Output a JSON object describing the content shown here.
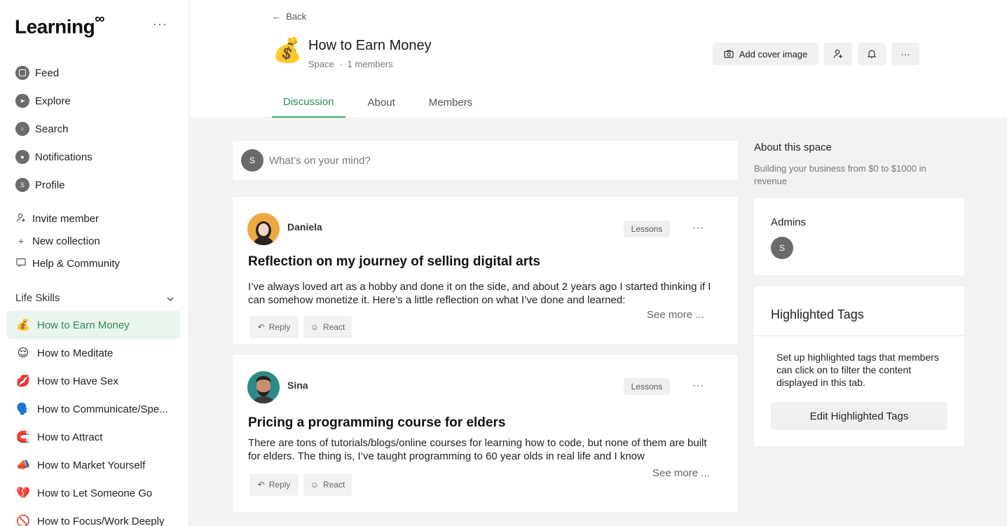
{
  "sidebar": {
    "logo": "Learning",
    "logo_mark": "∞",
    "more": "···",
    "nav": [
      {
        "label": "Feed",
        "icon": "feed-icon"
      },
      {
        "label": "Explore",
        "icon": "compass-icon"
      },
      {
        "label": "Search",
        "icon": "search-icon"
      },
      {
        "label": "Notifications",
        "icon": "bell-icon"
      },
      {
        "label": "Profile",
        "icon": "avatar-icon",
        "initial": "S"
      }
    ],
    "tools": [
      {
        "label": "Invite member",
        "icon": "person-plus-icon"
      },
      {
        "label": "New collection",
        "icon": "plus-icon"
      },
      {
        "label": "Help & Community",
        "icon": "chat-icon"
      }
    ],
    "section_title": "Life Skills",
    "spaces": [
      {
        "emoji": "💰",
        "label": "How to Earn Money"
      },
      {
        "emoji": "😌",
        "label": "How to Meditate"
      },
      {
        "emoji": "💋",
        "label": "How to Have Sex"
      },
      {
        "emoji": "🗣️",
        "label": "How to Communicate/Spe..."
      },
      {
        "emoji": "🧲",
        "label": "How to Attract"
      },
      {
        "emoji": "📣",
        "label": "How to Market Yourself"
      },
      {
        "emoji": "💔",
        "label": "How to Let Someone Go"
      },
      {
        "emoji": "🚫",
        "label": "How to Focus/Work Deeply"
      }
    ]
  },
  "header": {
    "back": "Back",
    "emoji": "💰",
    "title": "How to Earn Money",
    "type": "Space",
    "members": "1 members",
    "add_cover": "Add cover image",
    "more": "···",
    "tabs": [
      "Discussion",
      "About",
      "Members"
    ]
  },
  "composer": {
    "initial": "S",
    "placeholder": "What’s on your mind?"
  },
  "posts": [
    {
      "author": "Daniela",
      "tag": "Lessons",
      "title": "Reflection on my journey of selling digital arts",
      "body": "I’ve always loved art as a hobby and done it on the side, and about 2 years ago I started thinking if I can somehow monetize it. Here’s a little reflection on what I’ve done and learned:",
      "see_more": "See more ...",
      "reply": "Reply",
      "react": "React"
    },
    {
      "author": "Sina",
      "tag": "Lessons",
      "title": "Pricing a programming course for elders",
      "body": "There are tons of tutorials/blogs/online courses for learning how to code, but none of them are built for elders. The thing is, I’ve taught programming to 60 year olds in real life and I know",
      "see_more": "See more ...",
      "reply": "Reply",
      "react": "React"
    }
  ],
  "about": {
    "title": "About this space",
    "description": "Building your business from $0 to $1000 in revenue",
    "admins_title": "Admins",
    "admin_initial": "S"
  },
  "highlighted_tags": {
    "title": "Highlighted Tags",
    "description": "Set up highlighted tags that members can click on to filter the content displayed in this tab.",
    "button": "Edit Highlighted Tags"
  },
  "colors": {
    "accent": "#2e8b57",
    "active_bg": "#eaf5ee",
    "page_bg": "#f2f2f2"
  }
}
